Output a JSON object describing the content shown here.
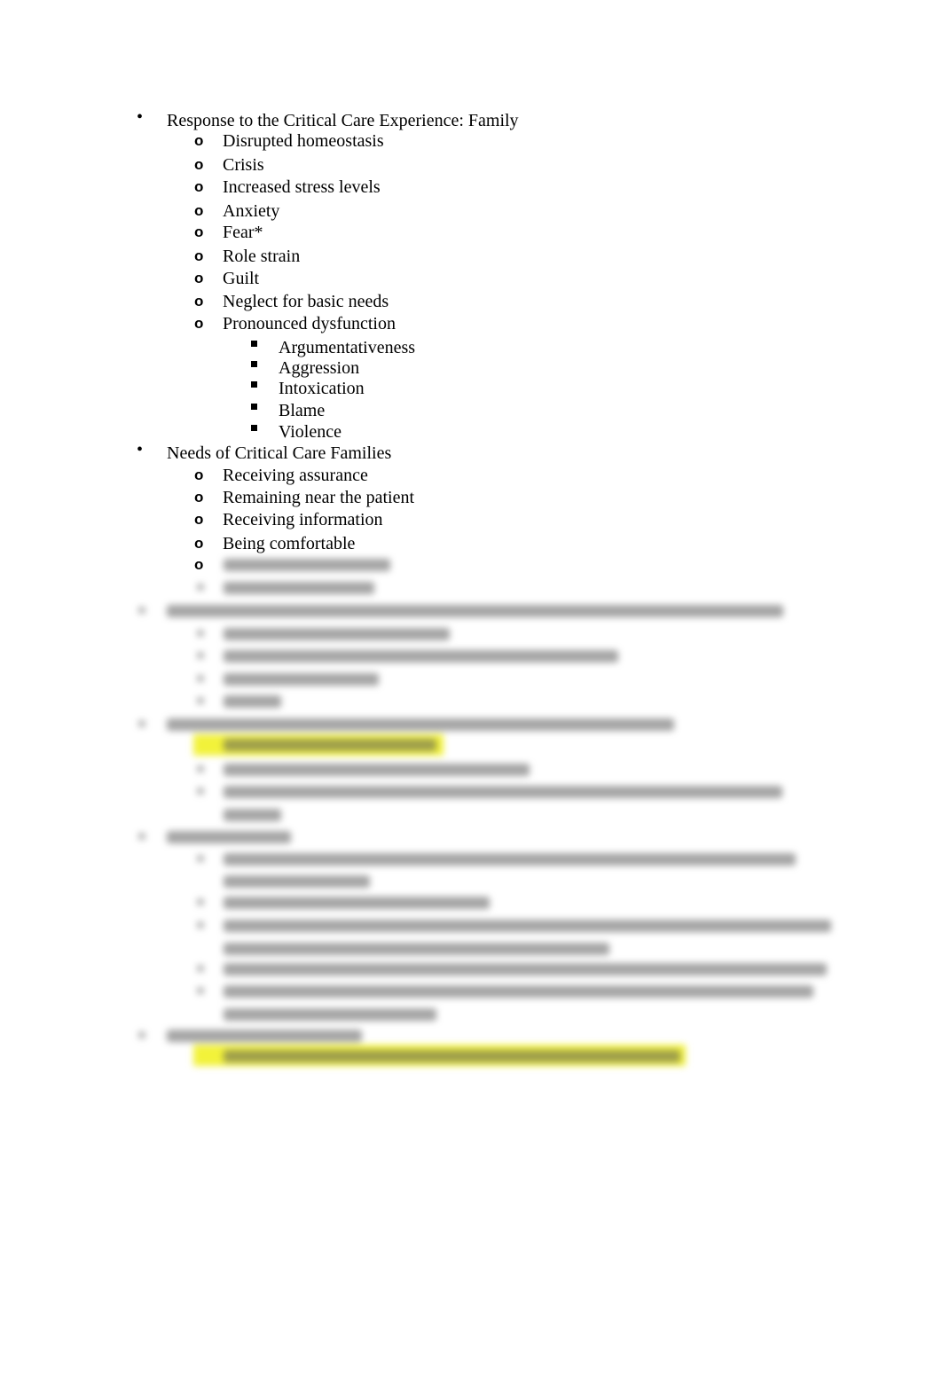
{
  "document": {
    "sections": [
      {
        "heading": "Response to the Critical Care Experience: Family",
        "items": [
          {
            "text": "Disrupted homeostasis"
          },
          {
            "text": "Crisis"
          },
          {
            "text": "Increased stress levels"
          },
          {
            "text": "Anxiety"
          },
          {
            "text": "Fear*"
          },
          {
            "text": "Role strain"
          },
          {
            "text": "Guilt"
          },
          {
            "text": "Neglect for basic needs"
          },
          {
            "text": "Pronounced dysfunction",
            "subitems": [
              "Argumentativeness",
              "Aggression",
              "Intoxication",
              "Blame",
              "Violence"
            ]
          }
        ]
      },
      {
        "heading": "Needs of Critical Care Families",
        "items": [
          {
            "text": "Receiving assurance"
          },
          {
            "text": "Remaining near the patient"
          },
          {
            "text": "Receiving information"
          },
          {
            "text": "Being comfortable"
          }
        ]
      }
    ],
    "bullets": {
      "level1": "•",
      "level2": "o",
      "level3": "■"
    },
    "blurred_content_note": "Remaining content is blurred and unreadable",
    "highlight_color": "#f2f23a"
  }
}
